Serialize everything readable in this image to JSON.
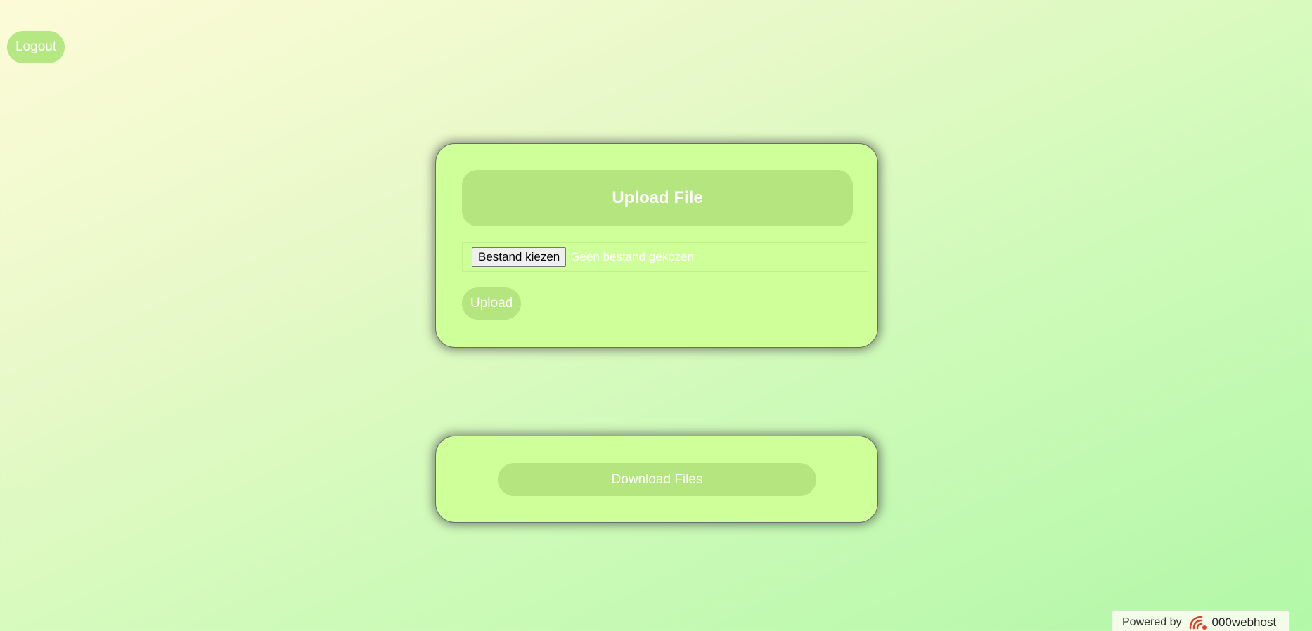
{
  "header": {
    "logout_label": "Logout"
  },
  "upload_card": {
    "title": "Upload File",
    "choose_file_label": "Bestand kiezen",
    "file_status": "Geen bestand gekozen",
    "upload_label": "Upload"
  },
  "download_card": {
    "download_label": "Download Files"
  },
  "footer": {
    "powered_by": "Powered by",
    "brand": "000webhost",
    "brand_icon": "000webhost-logo-icon"
  },
  "colors": {
    "card_bg": "#ceff98",
    "button_bg": "#b4e57f",
    "brand_icon_color": "#d9432b"
  }
}
